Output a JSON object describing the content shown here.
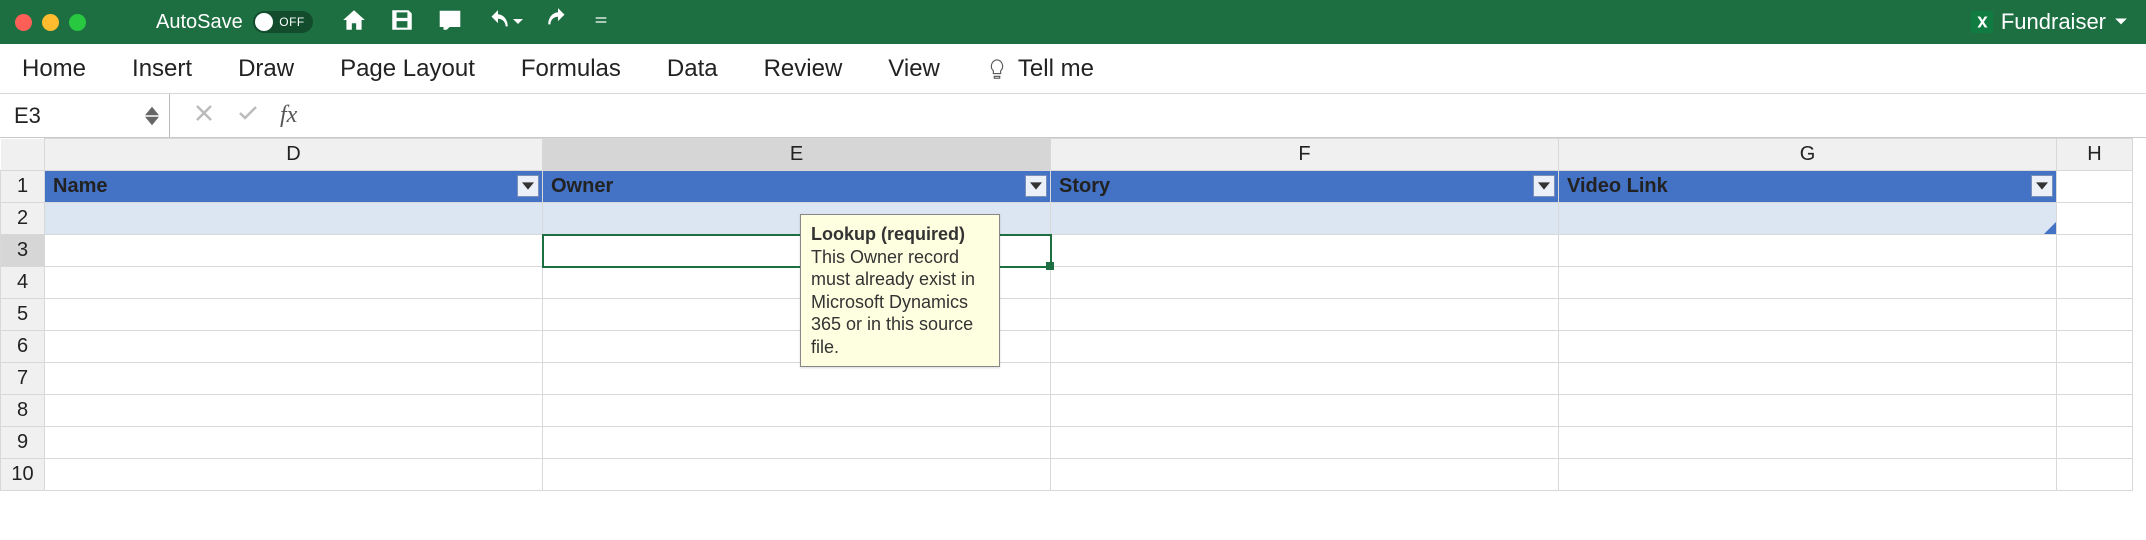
{
  "titlebar": {
    "autosave_label": "AutoSave",
    "autosave_state": "OFF",
    "filename": "Fundraiser"
  },
  "ribbon": {
    "tabs": [
      "Home",
      "Insert",
      "Draw",
      "Page Layout",
      "Formulas",
      "Data",
      "Review",
      "View"
    ],
    "tellme": "Tell me"
  },
  "formula_bar": {
    "cell_ref": "E3",
    "fx_label": "fx",
    "value": ""
  },
  "columns": [
    "D",
    "E",
    "F",
    "G",
    "H"
  ],
  "active_column": "E",
  "rows": [
    1,
    2,
    3,
    4,
    5,
    6,
    7,
    8,
    9,
    10
  ],
  "active_row": 3,
  "headers": {
    "D": "Name",
    "E": "Owner",
    "F": "Story",
    "G": "Video Link"
  },
  "tooltip": {
    "title": "Lookup (required)",
    "body": "This Owner record must already exist in Microsoft Dynamics 365 or in this source file."
  }
}
